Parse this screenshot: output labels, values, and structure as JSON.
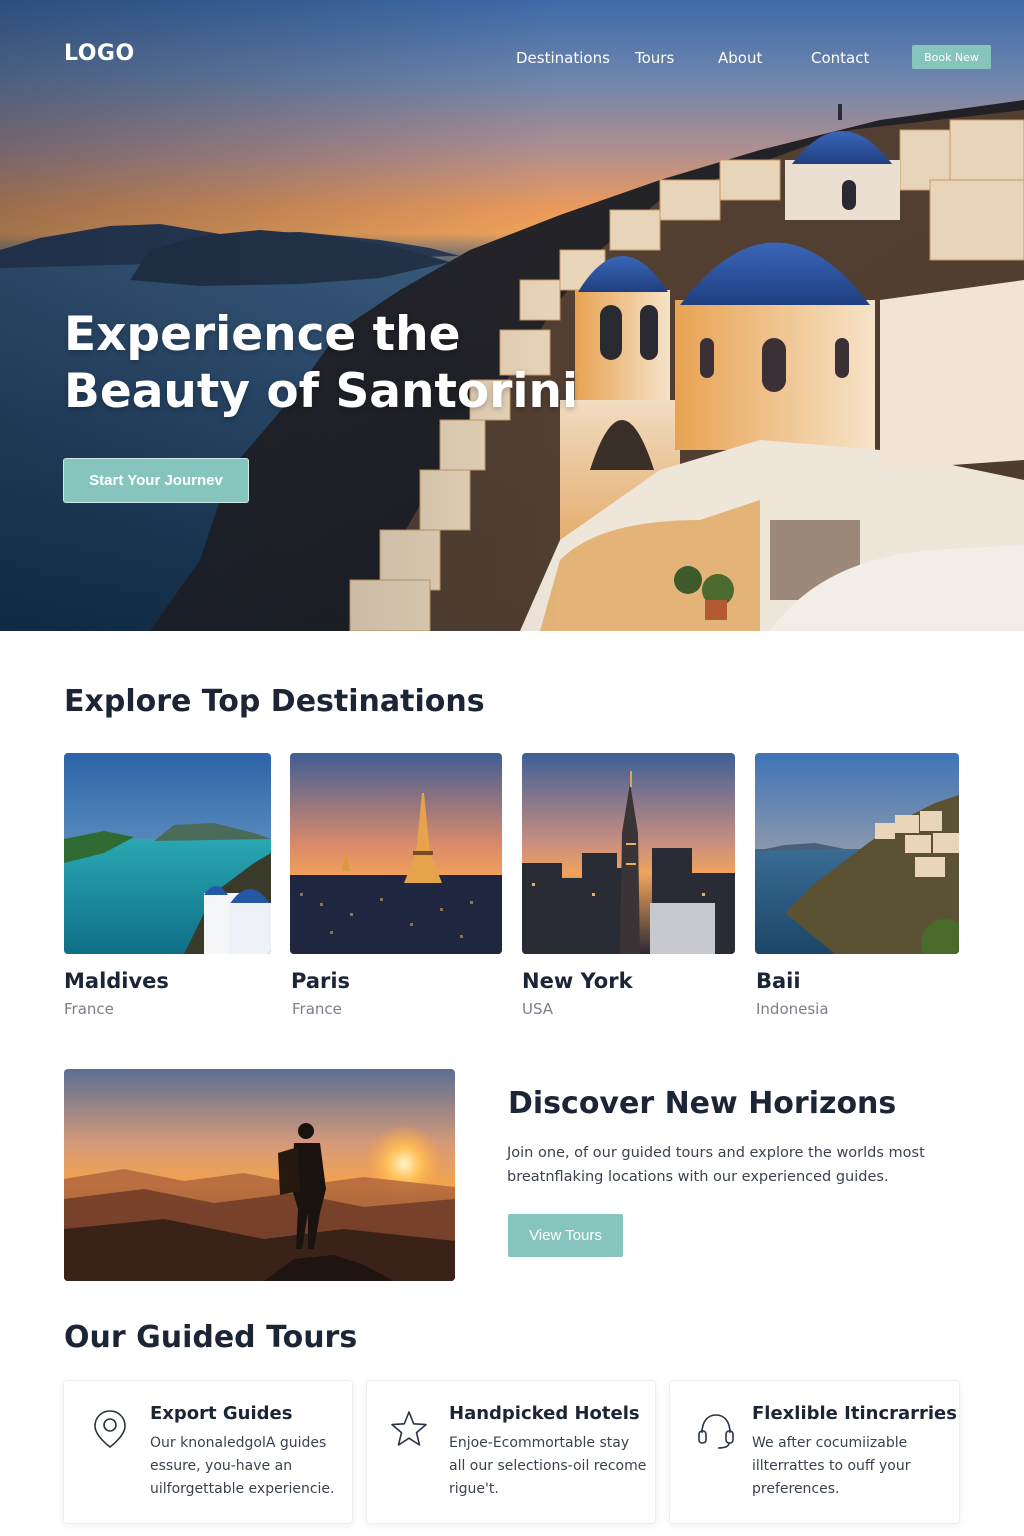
{
  "header": {
    "logo": "LOGO",
    "nav": [
      "Destinations",
      "Tours",
      "About",
      "Contact"
    ],
    "book_label": "Book New"
  },
  "hero": {
    "title_line1": "Experience the",
    "title_line2": "Beauty of Santorini",
    "cta_label": "Start Your Journev"
  },
  "destinations": {
    "title": "Explore Top Destinations",
    "cards": [
      {
        "name": "Maldives",
        "country": "France"
      },
      {
        "name": "Paris",
        "country": "France"
      },
      {
        "name": "New York",
        "country": "USA"
      },
      {
        "name": "Baii",
        "country": "Indonesia"
      }
    ]
  },
  "horizons": {
    "title": "Discover New Horizons",
    "text": "Join one, of our guided tours and explore the worlds most breatnflaking locations with our experienced guides.",
    "button_label": "View Tours"
  },
  "tours": {
    "title": "Our Guided Tours",
    "items": [
      {
        "icon": "map-pin-icon",
        "title": "Export Guides",
        "text": "Our knonaledgolA guides essure, you-have an uilforgettable experiencie."
      },
      {
        "icon": "star-icon",
        "title": "Handpicked Hotels",
        "text": "Enjoe-Ecommortable stay all our  selections-oil recome rigue't."
      },
      {
        "icon": "headset-icon",
        "title": "Flexlible Itincrarries",
        "text": "We after cocumiizable illterrattes to ouff your preferences."
      }
    ]
  },
  "colors": {
    "accent": "#86c5bd",
    "heading": "#1b2536",
    "muted": "#7a808a",
    "dome_blue": "#27519e"
  }
}
